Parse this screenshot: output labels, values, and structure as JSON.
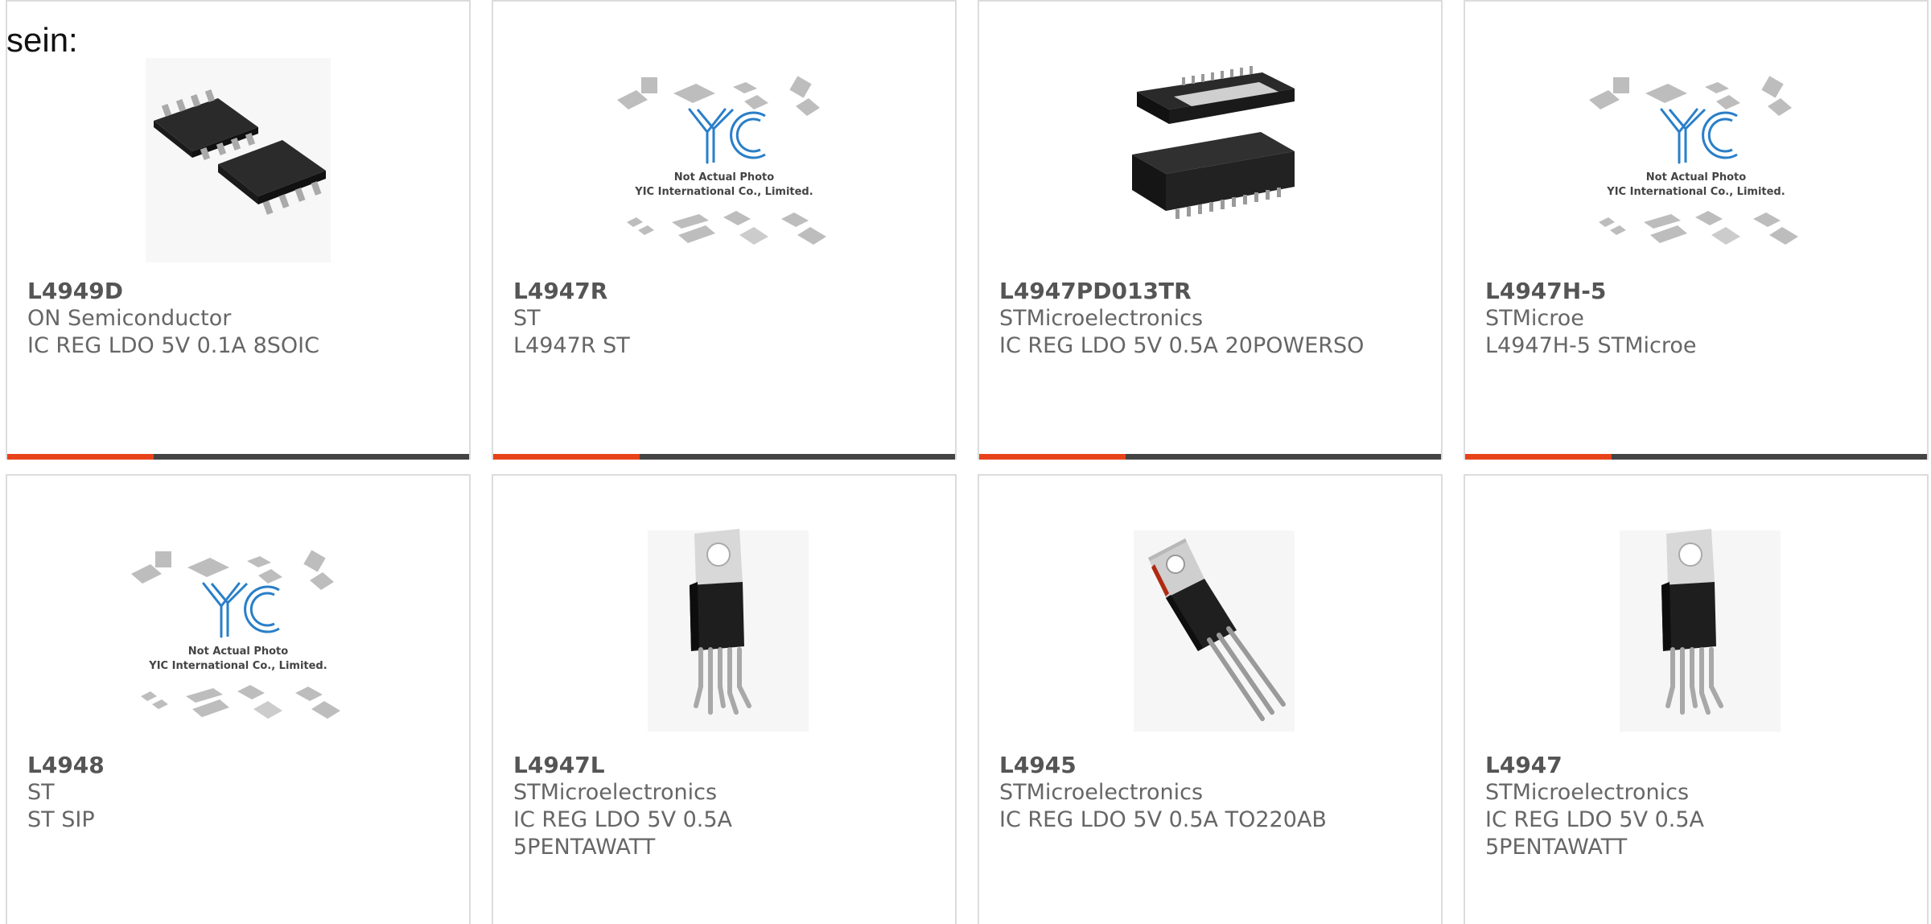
{
  "intro_text": "sein:",
  "colors": {
    "accent": "#e8421a",
    "bar": "#444444",
    "border": "#dcdcdc",
    "text": "#666666",
    "yic_logo": "#2a7fc8"
  },
  "products": [
    {
      "part": "L4949D",
      "manufacturer": "ON Semiconductor",
      "desc": "IC REG LDO 5V 0.1A 8SOIC",
      "image": "soic8-chip-icon"
    },
    {
      "part": "L4947R",
      "manufacturer": "ST",
      "desc": "L4947R ST",
      "image": "not-actual-photo-placeholder"
    },
    {
      "part": "L4947PD013TR",
      "manufacturer": "STMicroelectronics",
      "desc": "IC REG LDO 5V 0.5A 20POWERSO",
      "image": "powerso20-chip-icon"
    },
    {
      "part": "L4947H-5",
      "manufacturer": "STMicroe",
      "desc": "L4947H-5 STMicroe",
      "image": "not-actual-photo-placeholder"
    },
    {
      "part": "L4948",
      "manufacturer": "ST",
      "desc": "ST SIP",
      "image": "not-actual-photo-placeholder"
    },
    {
      "part": "L4947L",
      "manufacturer": "STMicroelectronics",
      "desc_line1": "IC REG LDO 5V 0.5A",
      "desc_line2": "5PENTAWATT",
      "image": "pentawatt-chip-icon"
    },
    {
      "part": "L4945",
      "manufacturer": "STMicroelectronics",
      "desc": "IC REG LDO 5V 0.5A TO220AB",
      "image": "to220-chip-icon"
    },
    {
      "part": "L4947",
      "manufacturer": "STMicroelectronics",
      "desc_line1": "IC REG LDO 5V 0.5A",
      "desc_line2": "5PENTAWATT",
      "image": "pentawatt-chip-icon"
    }
  ],
  "placeholder": {
    "logo_text": "YIC",
    "line1": "Not Actual Photo",
    "line2": "YIC International Co., Limited."
  }
}
